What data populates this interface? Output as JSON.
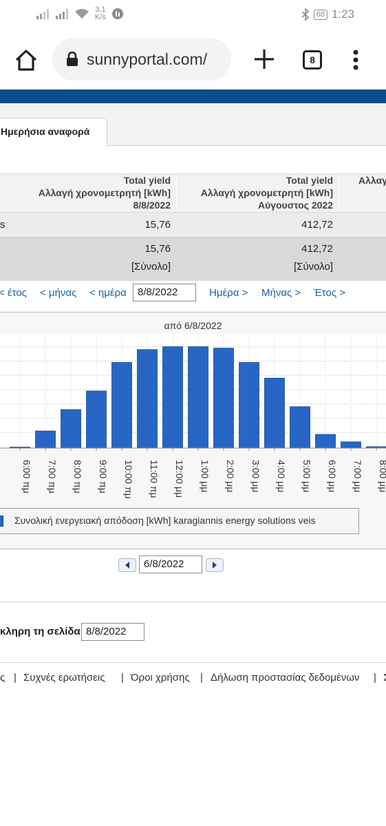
{
  "status_bar": {
    "network_speed_value": "3,1",
    "network_speed_unit": "K/s",
    "battery": "68",
    "time": "1:23",
    "icons": [
      "signal-icon",
      "signal-icon",
      "wifi-icon",
      "app-notification-icon",
      "bluetooth-icon",
      "battery-icon"
    ]
  },
  "browser": {
    "url": "sunnyportal.com/",
    "tab_count": "8",
    "icons": [
      "home-icon",
      "lock-icon",
      "plus-icon",
      "tab-switcher-icon",
      "more-vert-icon"
    ]
  },
  "header": {
    "accent_color": "#0b4f8a"
  },
  "tabs": {
    "active_label": "Ημερήσια αναφορά"
  },
  "table": {
    "columns": [
      {
        "line1": "Total yield",
        "line2": "Αλλαγή χρονομετρητή [kWh]",
        "line3": "8/8/2022"
      },
      {
        "line1": "Total yield",
        "line2": "Αλλαγή χρονομετρητή [kWh]",
        "line3": "Αύγουστος 2022"
      },
      {
        "line1": "",
        "line2": "Αλλαγ",
        "line3": ""
      }
    ],
    "row_label": "s",
    "row_values": [
      "15,76",
      "412,72"
    ],
    "total_values": [
      "15,76",
      "412,72"
    ],
    "total_label": "[Σύνολο]"
  },
  "nav": {
    "year_back": "< έτος",
    "month_back": "< μήνας",
    "day_back": "< ημέρα",
    "date": "8/8/2022",
    "day_forward": "Ημέρα >",
    "month_forward": "Μήνας >",
    "year_forward": "Έτος >"
  },
  "chart_title": "από 6/8/2022",
  "chart_data": {
    "type": "bar",
    "title": "από 6/8/2022",
    "categories": [
      "6:00 πμ",
      "7:00 πμ",
      "8:00 πμ",
      "9:00 πμ",
      "10:00 πμ",
      "11:00 πμ",
      "12:00 μμ",
      "1:00 μμ",
      "2:00 μμ",
      "3:00 μμ",
      "4:00 μμ",
      "5:00 μμ",
      "6:00 μμ",
      "7:00 μμ",
      "8:00 μμ"
    ],
    "series": [
      {
        "name": "Συνολική ενεργειακή απόδοση [kWh] karagiannis energy solutions veis",
        "values": [
          0.02,
          0.6,
          1.35,
          2.0,
          3.0,
          3.45,
          3.55,
          3.55,
          3.5,
          3.0,
          2.45,
          1.45,
          0.48,
          0.22,
          0.05
        ]
      }
    ],
    "ylim": [
      0,
      4
    ],
    "grid": true,
    "color": "#2766c4",
    "legend": "bottom"
  },
  "legend": {
    "label": "Συνολική ενεργειακή απόδοση [kWh] karagiannis energy solutions veis"
  },
  "pager": {
    "date": "6/8/2022"
  },
  "print": {
    "label": "κληρη τη σελίδα:",
    "date": "8/8/2022"
  },
  "footer": {
    "items": [
      "ς",
      "Συχνές ερωτήσεις",
      "Όροι χρήσης",
      "Δήλωση προστασίας δεδομένων",
      "Σ"
    ],
    "separator": "|"
  }
}
